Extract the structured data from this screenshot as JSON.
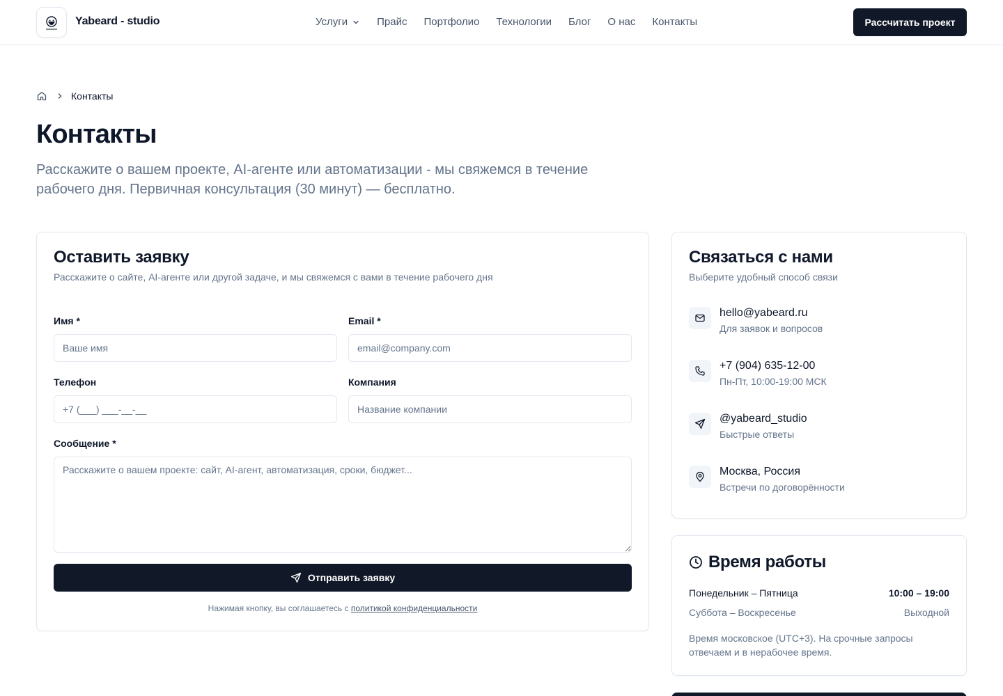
{
  "header": {
    "brand": "Yabeard - studio",
    "nav": [
      "Услуги",
      "Прайс",
      "Портфолио",
      "Технологии",
      "Блог",
      "О нас",
      "Контакты"
    ],
    "cta": "Рассчитать проект"
  },
  "breadcrumb": {
    "current": "Контакты"
  },
  "page": {
    "title": "Контакты",
    "subtitle": "Расскажите о вашем проекте, AI-агенте или автоматизации - мы свяжемся в течение рабочего дня. Первичная консультация (30 минут) — бесплатно."
  },
  "form": {
    "title": "Оставить заявку",
    "desc": "Расскажите о сайте, AI-агенте или другой задаче, и мы свяжемся с вами в течение рабочего дня",
    "name_label": "Имя *",
    "name_placeholder": "Ваше имя",
    "email_label": "Email *",
    "email_placeholder": "email@company.com",
    "phone_label": "Телефон",
    "phone_placeholder": "+7 (___) ___-__-__",
    "company_label": "Компания",
    "company_placeholder": "Название компании",
    "message_label": "Сообщение *",
    "message_placeholder": "Расскажите о вашем проекте: сайт, AI-агент, автоматизация, сроки, бюджет...",
    "submit": "Отправить заявку",
    "consent_text": "Нажимая кнопку, вы соглашаетесь с ",
    "consent_link": "политикой конфиденциальности"
  },
  "contact": {
    "title": "Связаться с нами",
    "desc": "Выберите удобный способ связи",
    "items": [
      {
        "icon": "mail-icon",
        "main": "hello@yabeard.ru",
        "sub": "Для заявок и вопросов"
      },
      {
        "icon": "phone-icon",
        "main": "+7 (904) 635-12-00",
        "sub": "Пн-Пт, 10:00-19:00 МСК"
      },
      {
        "icon": "telegram-icon",
        "main": "@yabeard_studio",
        "sub": "Быстрые ответы"
      },
      {
        "icon": "map-pin-icon",
        "main": "Москва, Россия",
        "sub": "Встречи по договорённости"
      }
    ]
  },
  "hours": {
    "title": "Время работы",
    "rows": [
      {
        "days": "Понедельник – Пятница",
        "time": "10:00 – 19:00"
      },
      {
        "days": "Суббота – Воскресенье",
        "time": "Выходной"
      }
    ],
    "note": "Время московское (UTC+3). На срочные запросы отвечаем и в нерабочее время."
  },
  "colors": {
    "primary": "#111827",
    "muted": "#64748b",
    "border": "#e2e8f0"
  }
}
